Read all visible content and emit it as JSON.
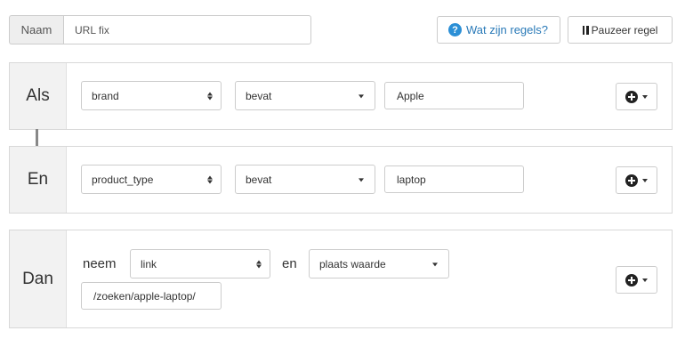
{
  "header": {
    "name_label": "Naam",
    "name_value": "URL fix",
    "help_button": "Wat zijn regels?",
    "help_icon": "question-circle-icon",
    "pause_button": "Pauzeer regel",
    "pause_icon": "pause-icon"
  },
  "conditions": [
    {
      "label": "Als",
      "field": "brand",
      "operator": "bevat",
      "value": "Apple"
    },
    {
      "label": "En",
      "field": "product_type",
      "operator": "bevat",
      "value": "laptop"
    }
  ],
  "action": {
    "label": "Dan",
    "verb": "neem",
    "field": "link",
    "connector": "en",
    "operation": "plaats waarde",
    "value": "/zoeken/apple-laptop/"
  },
  "add_button_icon": "plus-circle-icon",
  "colors": {
    "help_blue": "#2b8fd6",
    "link_blue": "#2a7ab8",
    "label_bg": "#f2f2f2",
    "border": "#cccccc"
  }
}
